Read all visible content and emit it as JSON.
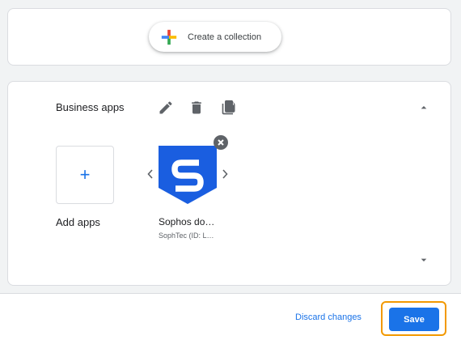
{
  "collections": {
    "create_button_label": "Create a collection",
    "create_icon": "multicolor-plus-icon"
  },
  "section": {
    "title": "Business apps",
    "tools": [
      "edit-icon",
      "delete-icon",
      "copy-icon"
    ],
    "collapse_icon": "caret-up-icon",
    "expand_icon": "caret-down-icon"
  },
  "add_tile": {
    "glyph": "+",
    "label": "Add apps"
  },
  "apps": [
    {
      "name": "Sophos do…",
      "developer": "SophTec (ID: L…",
      "icon": "sophos-shield-logo",
      "brand_color": "#1a5ee0"
    }
  ],
  "footer": {
    "discard_label": "Discard changes",
    "save_label": "Save"
  },
  "colors": {
    "accent": "#1a73e8",
    "focus_outline": "#f29900",
    "background": "#f1f3f4"
  }
}
